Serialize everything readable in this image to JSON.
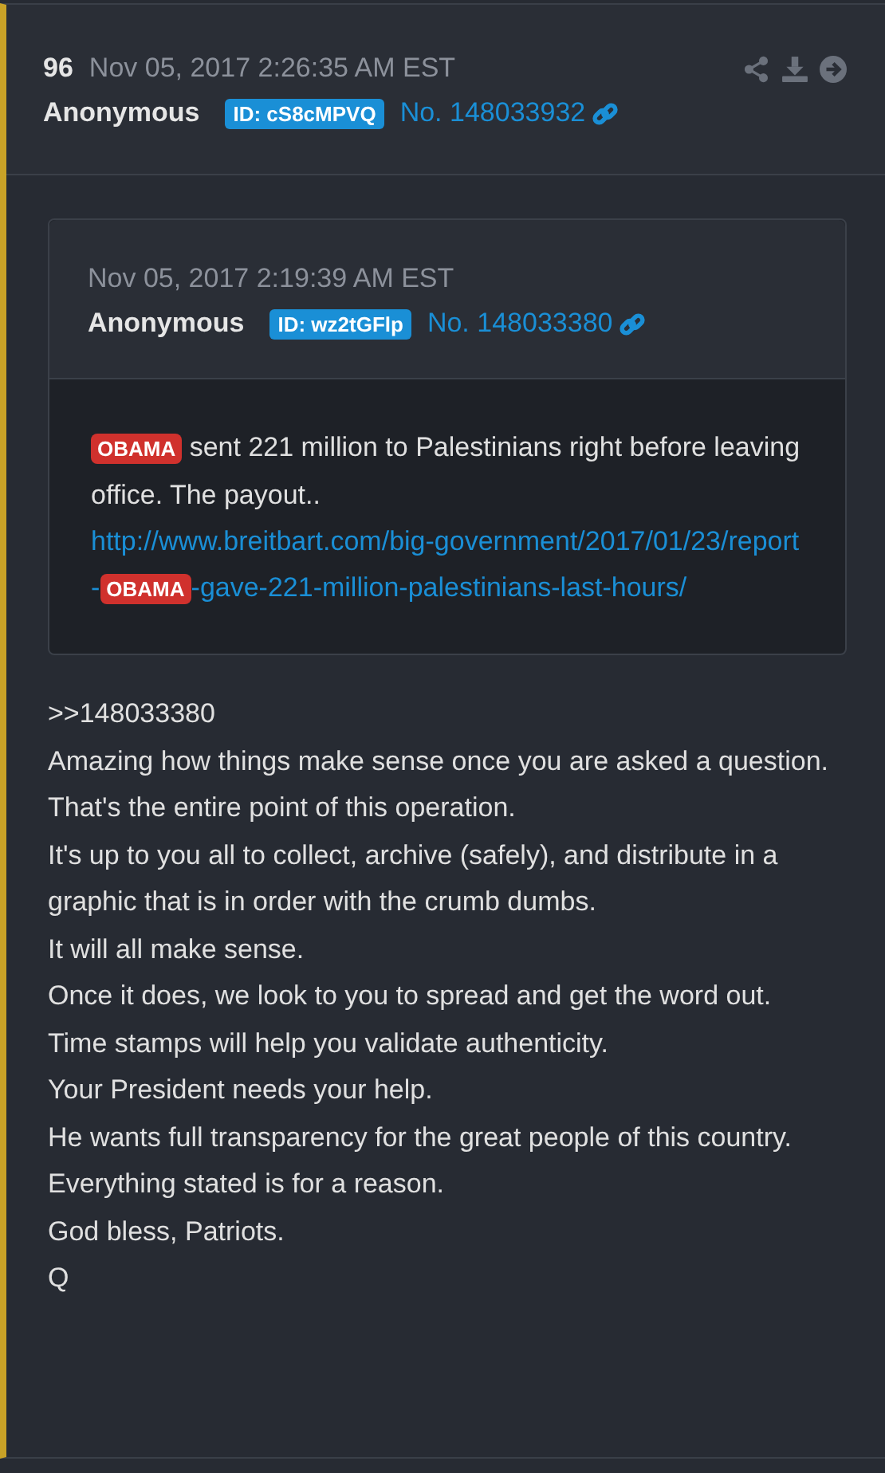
{
  "post": {
    "number": "96",
    "timestamp": "Nov 05, 2017 2:26:35 AM EST",
    "author": "Anonymous",
    "id_badge": "ID: cS8cMPVQ",
    "post_no": "No. 148033932"
  },
  "quote": {
    "timestamp": "Nov 05, 2017 2:19:39 AM EST",
    "author": "Anonymous",
    "id_badge": "ID: wz2tGFlp",
    "post_no": "No. 148033380",
    "text": [
      {
        "kind": "tag",
        "text": "OBAMA"
      },
      {
        "kind": "text",
        "text": " sent 221 million to Palestinians right before leaving office. The payout.."
      }
    ],
    "link": [
      {
        "kind": "text",
        "text": "http://www.breitbart.com/big-government/2017/01/23/report-"
      },
      {
        "kind": "tag",
        "text": "OBAMA"
      },
      {
        "kind": "text",
        "text": "-gave-221-million-palestinians-last-hours/"
      }
    ]
  },
  "body": [
    ">>148033380",
    "Amazing how things make sense once you are asked a question.",
    "That's the entire point of this operation.",
    "It's up to you all to collect, archive (safely), and distribute in a graphic that is in order with the crumb dumbs.",
    "It will all make sense.",
    "Once it does, we look to you to spread and get the word out.",
    "Time stamps will help you validate authenticity.",
    "Your President needs your help.",
    "He wants full transparency for the great people of this country.",
    "Everything stated is for a reason.",
    "God bless, Patriots.",
    "Q"
  ]
}
